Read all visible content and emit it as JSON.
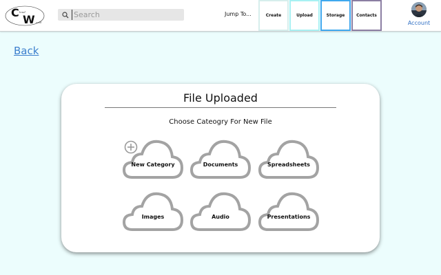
{
  "header": {
    "logo": {
      "text": "C W",
      "small_text": "loud orld"
    },
    "search": {
      "placeholder": "Search",
      "icon": "search-icon"
    },
    "jump_label": "Jump To...",
    "nav": [
      {
        "label": "Create",
        "color": "#d6eeec"
      },
      {
        "label": "Upload",
        "color": "#a7f1f3"
      },
      {
        "label": "Storage",
        "color": "#3fa8ee"
      },
      {
        "label": "Contacts",
        "color": "#8b7ea2"
      }
    ],
    "account_label": "Account"
  },
  "back_label": "Back",
  "card": {
    "title": "File Uploaded",
    "subtitle": "Choose Cateogry For New File",
    "categories": [
      {
        "label": "New Category",
        "icon": "cloud-icon"
      },
      {
        "label": "Documents",
        "icon": "cloud-icon"
      },
      {
        "label": "Spreadsheets",
        "icon": "cloud-icon"
      },
      {
        "label": "Images",
        "icon": "cloud-icon"
      },
      {
        "label": "Audio",
        "icon": "cloud-icon"
      },
      {
        "label": "Presentations",
        "icon": "cloud-icon"
      }
    ],
    "add_icon": "plus-circle-icon"
  },
  "colors": {
    "background": "#ecfdfd",
    "link": "#3c7fcd",
    "cloud_stroke": "#a3a3a3"
  }
}
